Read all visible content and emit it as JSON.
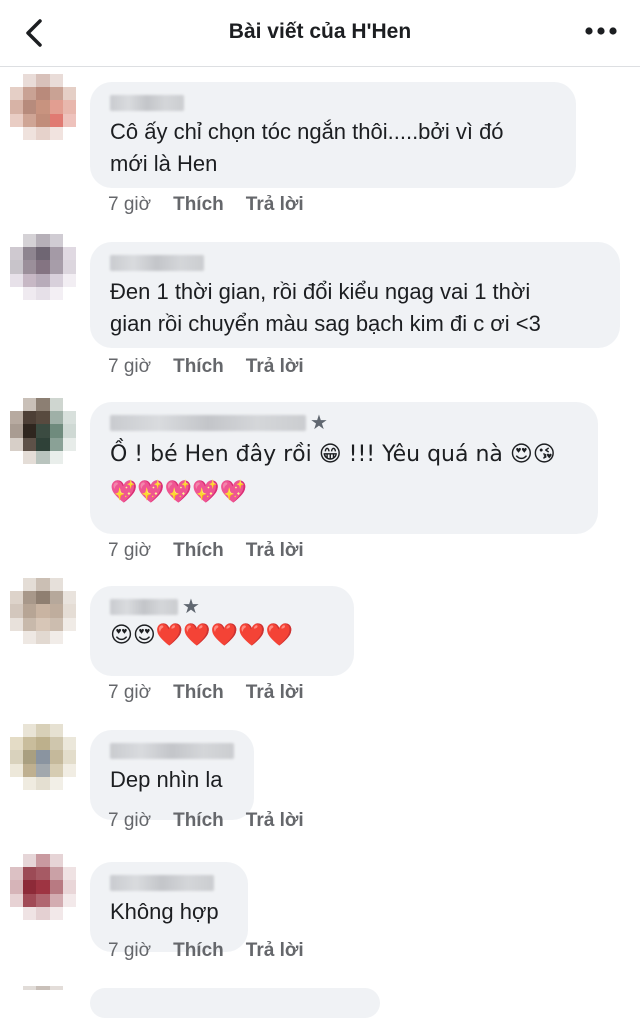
{
  "header": {
    "title": "Bài viết của H'Hen"
  },
  "comments": [
    {
      "text": "Cô ấy chỉ chọn tóc ngắn thôi.....bởi vì đó\nmới là Hen",
      "time": "7 giờ",
      "like": "Thích",
      "reply": "Trả lời"
    },
    {
      "text": "Đen 1 thời gian, rồi đổi kiểu ngag vai 1 thời\ngian rồi chuyển màu sag bạch kim đi c ơi <3",
      "time": "7 giờ",
      "like": "Thích",
      "reply": "Trả lời"
    },
    {
      "text": "Ồ ! bé Hen đây rồi 😁 !!! Yêu quá nà 😍😘\n💖💖💖💖💖",
      "time": "7 giờ",
      "like": "Thích",
      "reply": "Trả lời"
    },
    {
      "text": "😍😍❤️❤️❤️❤️❤️",
      "time": "7 giờ",
      "like": "Thích",
      "reply": "Trả lời"
    },
    {
      "text": "Dep nhìn la",
      "time": "7 giờ",
      "like": "Thích",
      "reply": "Trả lời"
    },
    {
      "text": "Không hợp",
      "time": "7 giờ",
      "like": "Thích",
      "reply": "Trả lời"
    }
  ],
  "icons": {
    "back": "back-arrow-icon",
    "more": "more-dots-icon",
    "badge": "star-badge-icon"
  }
}
